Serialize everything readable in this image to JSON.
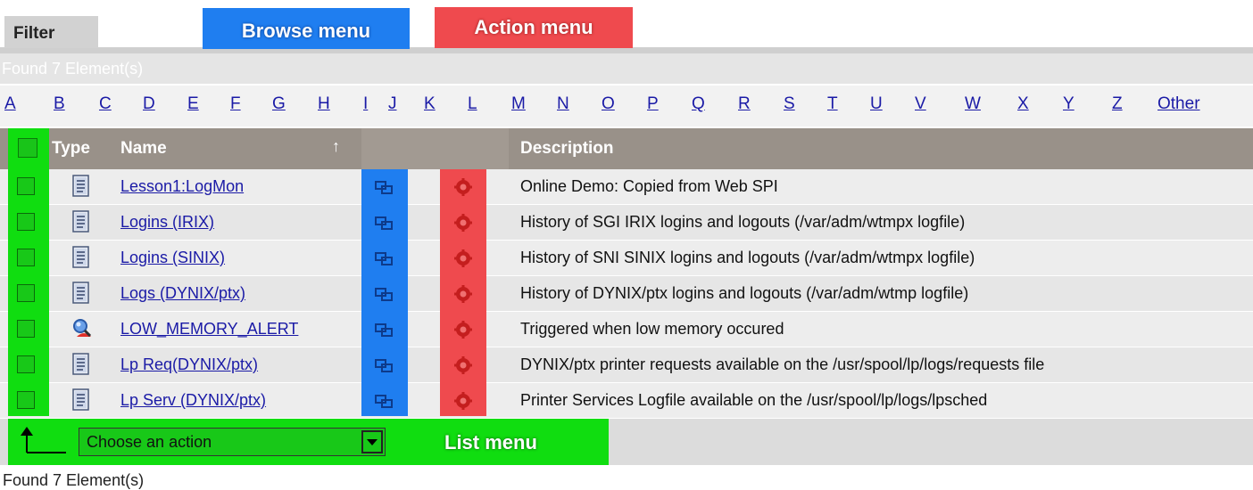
{
  "tabs": {
    "filter": "Filter",
    "browse_menu": "Browse menu",
    "action_menu": "Action menu"
  },
  "found_top": "Found 7 Element(s)",
  "alphabet": [
    "A",
    "B",
    "C",
    "D",
    "E",
    "F",
    "G",
    "H",
    "I",
    "J",
    "K",
    "L",
    "M",
    "N",
    "O",
    "P",
    "Q",
    "R",
    "S",
    "T",
    "U",
    "V",
    "W",
    "X",
    "Y",
    "Z",
    "Other"
  ],
  "table": {
    "columns": {
      "type": "Type",
      "name": "Name",
      "description": "Description"
    },
    "sort_icon": "sort-ascending-icon",
    "rows": [
      {
        "type_icon": "document-icon",
        "name": "Lesson1:LogMon",
        "description": "Online Demo: Copied from Web SPI"
      },
      {
        "type_icon": "document-icon",
        "name": "Logins (IRIX)",
        "description": "History of SGI IRIX logins and logouts (/var/adm/wtmpx logfile)"
      },
      {
        "type_icon": "document-icon",
        "name": "Logins (SINIX)",
        "description": "History of SNI SINIX logins and logouts (/var/adm/wtmpx logfile)"
      },
      {
        "type_icon": "document-icon",
        "name": "Logs (DYNIX/ptx)",
        "description": "History of DYNIX/ptx logins and logouts (/var/adm/wtmp logfile)"
      },
      {
        "type_icon": "alert-monitor-icon",
        "name": "LOW_MEMORY_ALERT",
        "description": "Triggered when low memory occured"
      },
      {
        "type_icon": "document-icon",
        "name": "Lp Req(DYNIX/ptx)",
        "description": "DYNIX/ptx printer requests available on the /usr/spool/lp/logs/requests file"
      },
      {
        "type_icon": "document-icon",
        "name": "Lp Serv (DYNIX/ptx)",
        "description": "Printer Services Logfile available on the /usr/spool/lp/logs/lpsched"
      }
    ]
  },
  "list_menu": {
    "select_value": "Choose an action",
    "label": "List menu"
  },
  "found_bottom": "Found 7 Element(s)",
  "colors": {
    "browse": "#1f7ef0",
    "action": "#ef4a4e",
    "list": "#10dd10",
    "header": "#999189",
    "link": "#1a1aa6"
  }
}
